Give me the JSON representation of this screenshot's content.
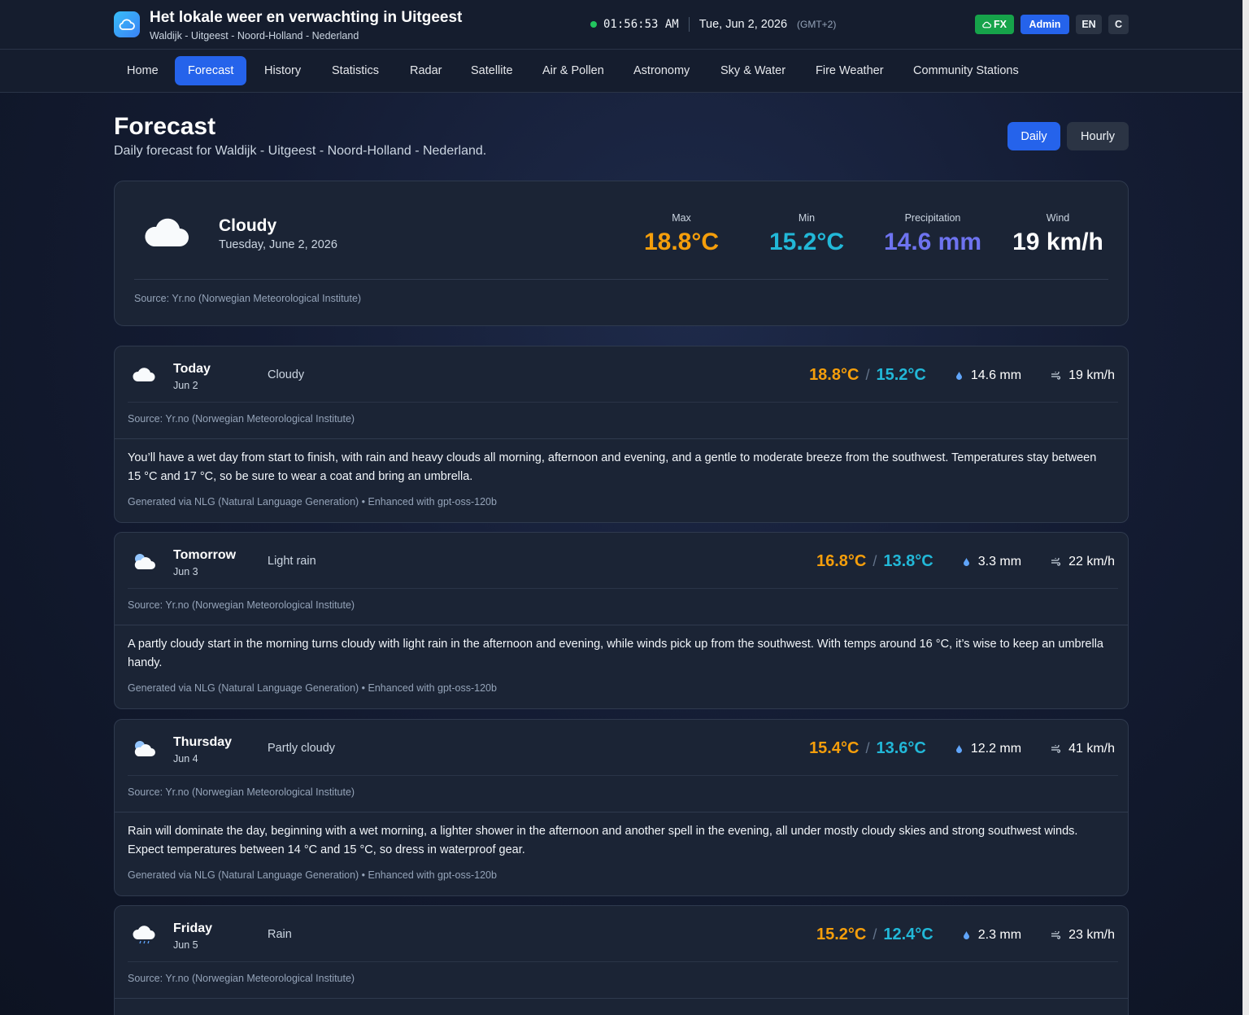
{
  "header": {
    "title": "Het lokale weer en verwachting in Uitgeest",
    "subtitle": "Waldijk - Uitgeest - Noord-Holland - Nederland",
    "time": "01:56:53 AM",
    "date": "Tue, Jun 2, 2026",
    "timezone": "(GMT+2)",
    "fx_label": "FX",
    "admin_label": "Admin",
    "lang_label": "EN",
    "unit_label": "C"
  },
  "nav": {
    "items": [
      "Home",
      "Forecast",
      "History",
      "Statistics",
      "Radar",
      "Satellite",
      "Air & Pollen",
      "Astronomy",
      "Sky & Water",
      "Fire Weather",
      "Community Stations"
    ],
    "active": "Forecast"
  },
  "page": {
    "title": "Forecast",
    "subtitle": "Daily forecast for Waldijk - Uitgeest - Noord-Holland - Nederland.",
    "view_daily": "Daily",
    "view_hourly": "Hourly"
  },
  "summary": {
    "condition": "Cloudy",
    "date": "Tuesday, June 2, 2026",
    "max_label": "Max",
    "max_value": "18.8°C",
    "min_label": "Min",
    "min_value": "15.2°C",
    "precip_label": "Precipitation",
    "precip_value": "14.6 mm",
    "wind_label": "Wind",
    "wind_value": "19 km/h",
    "source": "Source: Yr.no (Norwegian Meteorological Institute)",
    "icon": "cloud-icon"
  },
  "days": [
    {
      "name": "Today",
      "date": "Jun 2",
      "condition": "Cloudy",
      "icon": "cloud-icon",
      "max": "18.8°C",
      "min": "15.2°C",
      "precip": "14.6 mm",
      "wind": "19 km/h",
      "source": "Source: Yr.no (Norwegian Meteorological Institute)",
      "description": "You’ll have a wet day from start to finish, with rain and heavy clouds all morning, afternoon and evening, and a gentle to moderate breeze from the southwest. Temperatures stay between 15 °C and 17 °C, so be sure to wear a coat and bring an umbrella.",
      "generated": "Generated via NLG (Natural Language Generation) • Enhanced with gpt-oss-120b"
    },
    {
      "name": "Tomorrow",
      "date": "Jun 3",
      "condition": "Light rain",
      "icon": "partly-cloudy-icon",
      "max": "16.8°C",
      "min": "13.8°C",
      "precip": "3.3 mm",
      "wind": "22 km/h",
      "source": "Source: Yr.no (Norwegian Meteorological Institute)",
      "description": "A partly cloudy start in the morning turns cloudy with light rain in the afternoon and evening, while winds pick up from the southwest. With temps around 16 °C, it’s wise to keep an umbrella handy.",
      "generated": "Generated via NLG (Natural Language Generation) • Enhanced with gpt-oss-120b"
    },
    {
      "name": "Thursday",
      "date": "Jun 4",
      "condition": "Partly cloudy",
      "icon": "partly-cloudy-icon",
      "max": "15.4°C",
      "min": "13.6°C",
      "precip": "12.2 mm",
      "wind": "41 km/h",
      "source": "Source: Yr.no (Norwegian Meteorological Institute)",
      "description": "Rain will dominate the day, beginning with a wet morning, a lighter shower in the afternoon and another spell in the evening, all under mostly cloudy skies and strong southwest winds. Expect temperatures between 14 °C and 15 °C, so dress in waterproof gear.",
      "generated": "Generated via NLG (Natural Language Generation) • Enhanced with gpt-oss-120b"
    },
    {
      "name": "Friday",
      "date": "Jun 5",
      "condition": "Rain",
      "icon": "rain-cloud-icon",
      "max": "15.2°C",
      "min": "12.4°C",
      "precip": "2.3 mm",
      "wind": "23 km/h",
      "source": "Source: Yr.no (Norwegian Meteorological Institute)"
    }
  ],
  "colors": {
    "accent": "#2563eb",
    "max_temp": "#f59e0b",
    "min_temp": "#22b8d8",
    "precip": "#6e73f0",
    "live_dot": "#22c55e",
    "fx": "#16a34a"
  }
}
